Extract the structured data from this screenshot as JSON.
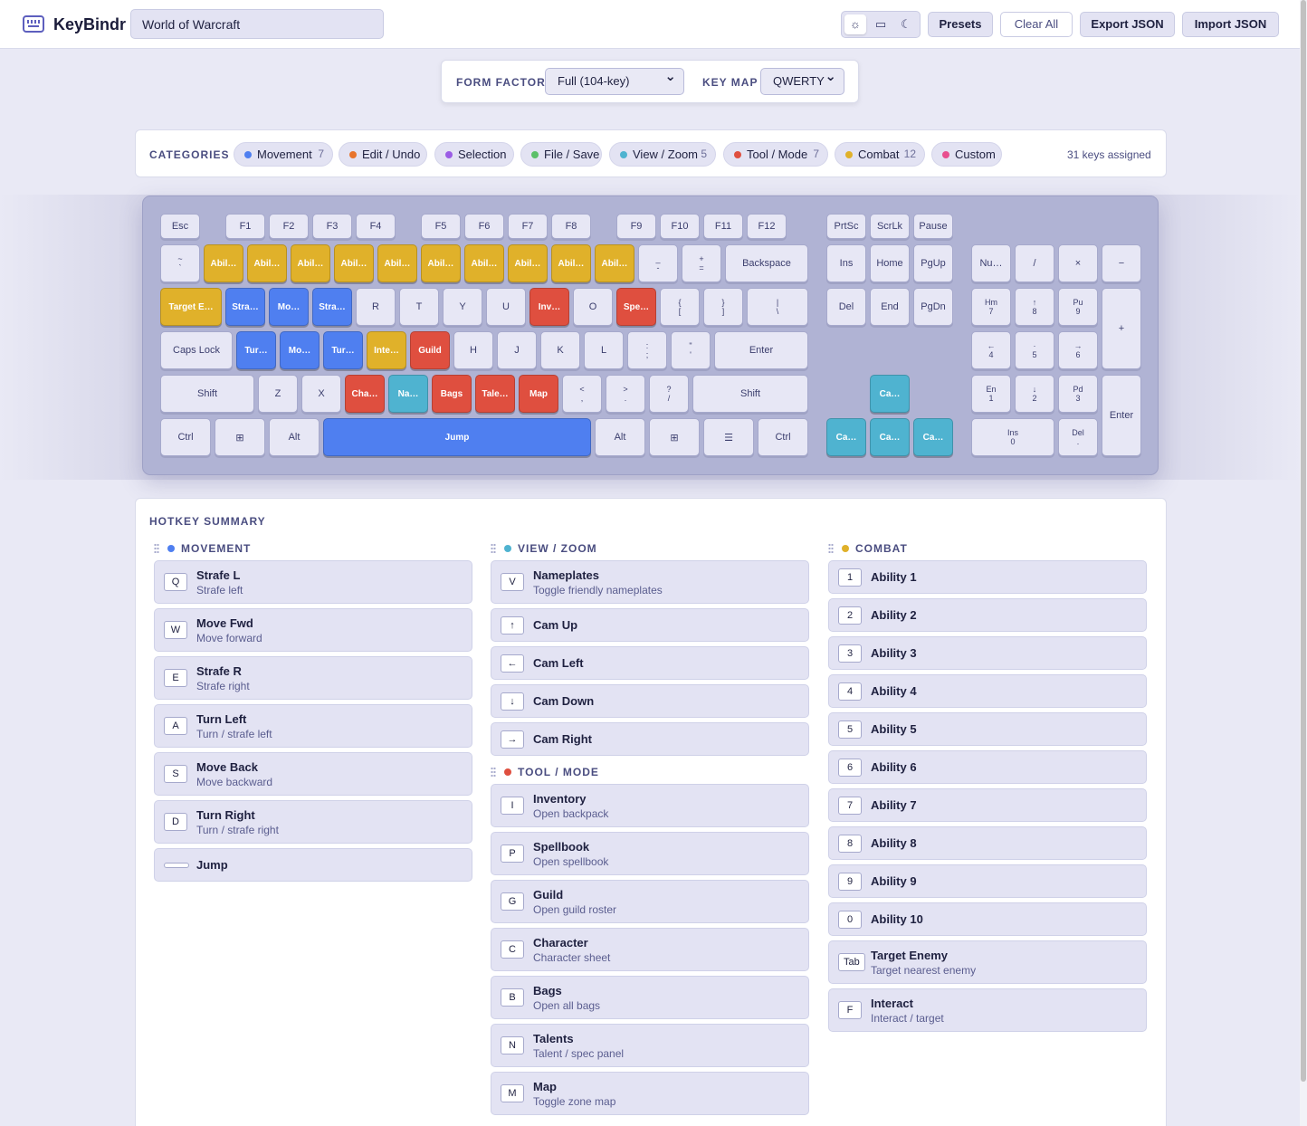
{
  "header": {
    "brand": "KeyBindr",
    "search_value": "World of Warcraft",
    "buttons": {
      "presets": "Presets",
      "clear": "Clear All",
      "export": "Export JSON",
      "import": "Import JSON"
    },
    "theme_icons": [
      "sun-icon",
      "monitor-icon",
      "moon-icon"
    ]
  },
  "settings": {
    "form_factor_label": "FORM FACTOR",
    "form_factor": "Full (104-key)",
    "keymap_label": "KEY MAP",
    "keymap": "QWERTY"
  },
  "categories": {
    "label": "CATEGORIES",
    "assigned": "31 keys assigned",
    "chips": [
      {
        "name": "Movement",
        "count": "7",
        "color": "#4f7ff0"
      },
      {
        "name": "Edit / Undo",
        "count": "",
        "color": "#e8742c"
      },
      {
        "name": "Selection",
        "count": "",
        "color": "#9b5de5"
      },
      {
        "name": "File / Save",
        "count": "",
        "color": "#5cc06a"
      },
      {
        "name": "View / Zoom",
        "count": "5",
        "color": "#4fb3d0"
      },
      {
        "name": "Tool / Mode",
        "count": "7",
        "color": "#df4f3f"
      },
      {
        "name": "Combat",
        "count": "12",
        "color": "#e0b12a"
      },
      {
        "name": "Custom",
        "count": "",
        "color": "#e84f8f"
      }
    ]
  },
  "keys": [
    {
      "l": "Esc"
    },
    {
      "l": "F1"
    },
    {
      "l": "F2"
    },
    {
      "l": "F3"
    },
    {
      "l": "F4"
    },
    {
      "l": "F5"
    },
    {
      "l": "F6"
    },
    {
      "l": "F7"
    },
    {
      "l": "F8"
    },
    {
      "l": "F9"
    },
    {
      "l": "F10"
    },
    {
      "l": "F11"
    },
    {
      "l": "F12"
    },
    {
      "l": "PrtSc"
    },
    {
      "l": "ScrLk"
    },
    {
      "l": "Pause"
    },
    {
      "l": "~\n`"
    },
    {
      "l": "Abil…",
      "c": "c"
    },
    {
      "l": "Abil…",
      "c": "c"
    },
    {
      "l": "Abil…",
      "c": "c"
    },
    {
      "l": "Abil…",
      "c": "c"
    },
    {
      "l": "Abil…",
      "c": "c"
    },
    {
      "l": "Abil…",
      "c": "c"
    },
    {
      "l": "Abil…",
      "c": "c"
    },
    {
      "l": "Abil…",
      "c": "c"
    },
    {
      "l": "Abil…",
      "c": "c"
    },
    {
      "l": "Abil…",
      "c": "c"
    },
    {
      "l": "_\n-"
    },
    {
      "l": "+\n="
    },
    {
      "l": "Backspace"
    },
    {
      "l": "Ins"
    },
    {
      "l": "Home"
    },
    {
      "l": "PgUp"
    },
    {
      "l": "Nu…"
    },
    {
      "l": "/"
    },
    {
      "l": "×"
    },
    {
      "l": "−"
    },
    {
      "l": "Target E…",
      "c": "c"
    },
    {
      "l": "Stra…",
      "c": "m"
    },
    {
      "l": "Mo…",
      "c": "m"
    },
    {
      "l": "Stra…",
      "c": "m"
    },
    {
      "l": "R"
    },
    {
      "l": "T"
    },
    {
      "l": "Y"
    },
    {
      "l": "U"
    },
    {
      "l": "Inv…",
      "c": "t"
    },
    {
      "l": "O"
    },
    {
      "l": "Spe…",
      "c": "t"
    },
    {
      "l": "{\n["
    },
    {
      "l": "}\n]"
    },
    {
      "l": "|\n\\"
    },
    {
      "l": "Del"
    },
    {
      "l": "End"
    },
    {
      "l": "PgDn"
    },
    {
      "l": "Hm\n7"
    },
    {
      "l": "↑\n8"
    },
    {
      "l": "Pu\n9"
    },
    {
      "l": "+"
    },
    {
      "l": "Caps Lock"
    },
    {
      "l": "Tur…",
      "c": "m"
    },
    {
      "l": "Mo…",
      "c": "m"
    },
    {
      "l": "Tur…",
      "c": "m"
    },
    {
      "l": "Inte…",
      "c": "c"
    },
    {
      "l": "Guild",
      "c": "t"
    },
    {
      "l": "H"
    },
    {
      "l": "J"
    },
    {
      "l": "K"
    },
    {
      "l": "L"
    },
    {
      "l": ":\n;"
    },
    {
      "l": "\"\n'"
    },
    {
      "l": "Enter"
    },
    {
      "l": "←\n4"
    },
    {
      "l": "·\n5"
    },
    {
      "l": "→\n6"
    },
    {
      "l": "Shift"
    },
    {
      "l": "Z"
    },
    {
      "l": "X"
    },
    {
      "l": "Cha…",
      "c": "t"
    },
    {
      "l": "Na…",
      "c": "v"
    },
    {
      "l": "Bags",
      "c": "t"
    },
    {
      "l": "Tale…",
      "c": "t"
    },
    {
      "l": "Map",
      "c": "t"
    },
    {
      "l": "<\n,"
    },
    {
      "l": ">\n."
    },
    {
      "l": "?\n/"
    },
    {
      "l": "Shift"
    },
    {
      "l": "Ca…",
      "c": "v"
    },
    {
      "l": "En\n1"
    },
    {
      "l": "↓\n2"
    },
    {
      "l": "Pd\n3"
    },
    {
      "l": "Enter"
    },
    {
      "l": "Ctrl"
    },
    {
      "l": "⊞"
    },
    {
      "l": "Alt"
    },
    {
      "l": "Jump",
      "c": "m"
    },
    {
      "l": "Alt"
    },
    {
      "l": "⊞"
    },
    {
      "l": "☰"
    },
    {
      "l": "Ctrl"
    },
    {
      "l": "Ca…",
      "c": "v"
    },
    {
      "l": "Ca…",
      "c": "v"
    },
    {
      "l": "Ca…",
      "c": "v"
    },
    {
      "l": "Ins\n0"
    },
    {
      "l": "Del\n."
    }
  ],
  "colors": {
    "m": "#4f7ff0",
    "c": "#e0b12a",
    "t": "#df4f3f",
    "v": "#4fb3d0"
  },
  "summary": {
    "title": "HOTKEY SUMMARY",
    "groups": [
      {
        "name": "MOVEMENT",
        "color": "#4f7ff0",
        "items": [
          {
            "key": "Q",
            "title": "Strafe L",
            "desc": "Strafe left"
          },
          {
            "key": "W",
            "title": "Move Fwd",
            "desc": "Move forward"
          },
          {
            "key": "E",
            "title": "Strafe R",
            "desc": "Strafe right"
          },
          {
            "key": "A",
            "title": "Turn Left",
            "desc": "Turn / strafe left"
          },
          {
            "key": "S",
            "title": "Move Back",
            "desc": "Move backward"
          },
          {
            "key": "D",
            "title": "Turn Right",
            "desc": "Turn / strafe right"
          },
          {
            "key": "",
            "title": "Jump",
            "desc": ""
          }
        ]
      },
      {
        "name": "VIEW / ZOOM",
        "color": "#4fb3d0",
        "items": [
          {
            "key": "V",
            "title": "Nameplates",
            "desc": "Toggle friendly nameplates"
          },
          {
            "key": "↑",
            "title": "Cam Up",
            "desc": ""
          },
          {
            "key": "←",
            "title": "Cam Left",
            "desc": ""
          },
          {
            "key": "↓",
            "title": "Cam Down",
            "desc": ""
          },
          {
            "key": "→",
            "title": "Cam Right",
            "desc": ""
          }
        ]
      },
      {
        "name": "TOOL / MODE",
        "color": "#df4f3f",
        "items": [
          {
            "key": "I",
            "title": "Inventory",
            "desc": "Open backpack"
          },
          {
            "key": "P",
            "title": "Spellbook",
            "desc": "Open spellbook"
          },
          {
            "key": "G",
            "title": "Guild",
            "desc": "Open guild roster"
          },
          {
            "key": "C",
            "title": "Character",
            "desc": "Character sheet"
          },
          {
            "key": "B",
            "title": "Bags",
            "desc": "Open all bags"
          },
          {
            "key": "N",
            "title": "Talents",
            "desc": "Talent / spec panel"
          },
          {
            "key": "M",
            "title": "Map",
            "desc": "Toggle zone map"
          }
        ]
      },
      {
        "name": "COMBAT",
        "color": "#e0b12a",
        "items": [
          {
            "key": "1",
            "title": "Ability 1",
            "desc": ""
          },
          {
            "key": "2",
            "title": "Ability 2",
            "desc": ""
          },
          {
            "key": "3",
            "title": "Ability 3",
            "desc": ""
          },
          {
            "key": "4",
            "title": "Ability 4",
            "desc": ""
          },
          {
            "key": "5",
            "title": "Ability 5",
            "desc": ""
          },
          {
            "key": "6",
            "title": "Ability 6",
            "desc": ""
          },
          {
            "key": "7",
            "title": "Ability 7",
            "desc": ""
          },
          {
            "key": "8",
            "title": "Ability 8",
            "desc": ""
          },
          {
            "key": "9",
            "title": "Ability 9",
            "desc": ""
          },
          {
            "key": "0",
            "title": "Ability 10",
            "desc": ""
          },
          {
            "key": "Tab",
            "title": "Target Enemy",
            "desc": "Target nearest enemy"
          },
          {
            "key": "F",
            "title": "Interact",
            "desc": "Interact / target"
          }
        ]
      }
    ]
  }
}
